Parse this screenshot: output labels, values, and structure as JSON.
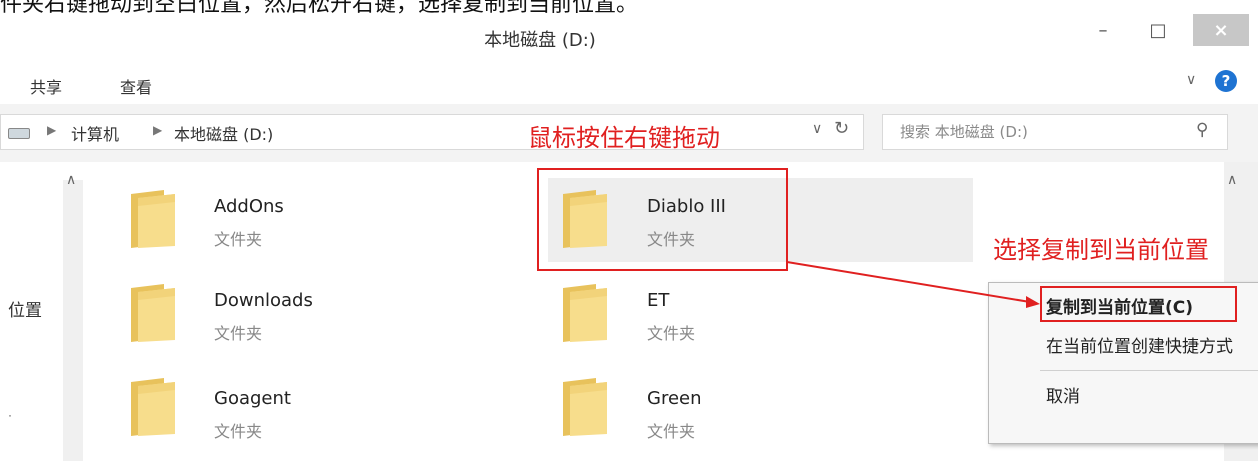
{
  "caption": "件夹右键拖动到空白位置，然后松开右键，选择复制到当前位置。",
  "window": {
    "title": "本地磁盘 (D:)",
    "minimize": "–",
    "maximize": "□",
    "close": "×"
  },
  "ribbon": {
    "tabs": [
      "共享",
      "查看"
    ]
  },
  "address": {
    "crumbs": [
      "计算机",
      "本地磁盘 (D:)"
    ],
    "search_placeholder": "搜索 本地磁盘 (D:)"
  },
  "nav": {
    "items": [
      "位置",
      "ׅ"
    ]
  },
  "folders": [
    {
      "name": "AddOns",
      "type": "文件夹"
    },
    {
      "name": "Diablo III",
      "type": "文件夹"
    },
    {
      "name": "Downloads",
      "type": "文件夹"
    },
    {
      "name": "ET",
      "type": "文件夹"
    },
    {
      "name": "Goagent",
      "type": "文件夹"
    },
    {
      "name": "Green",
      "type": "文件夹"
    }
  ],
  "annotations": {
    "drag": "鼠标按住右键拖动",
    "copy": "选择复制到当前位置"
  },
  "context_menu": {
    "items": [
      "复制到当前位置(C)",
      "在当前位置创建快捷方式",
      "取消"
    ]
  },
  "colors": {
    "annotation": "#e02020",
    "help": "#1e73d2",
    "folder": "#f2d37a"
  }
}
